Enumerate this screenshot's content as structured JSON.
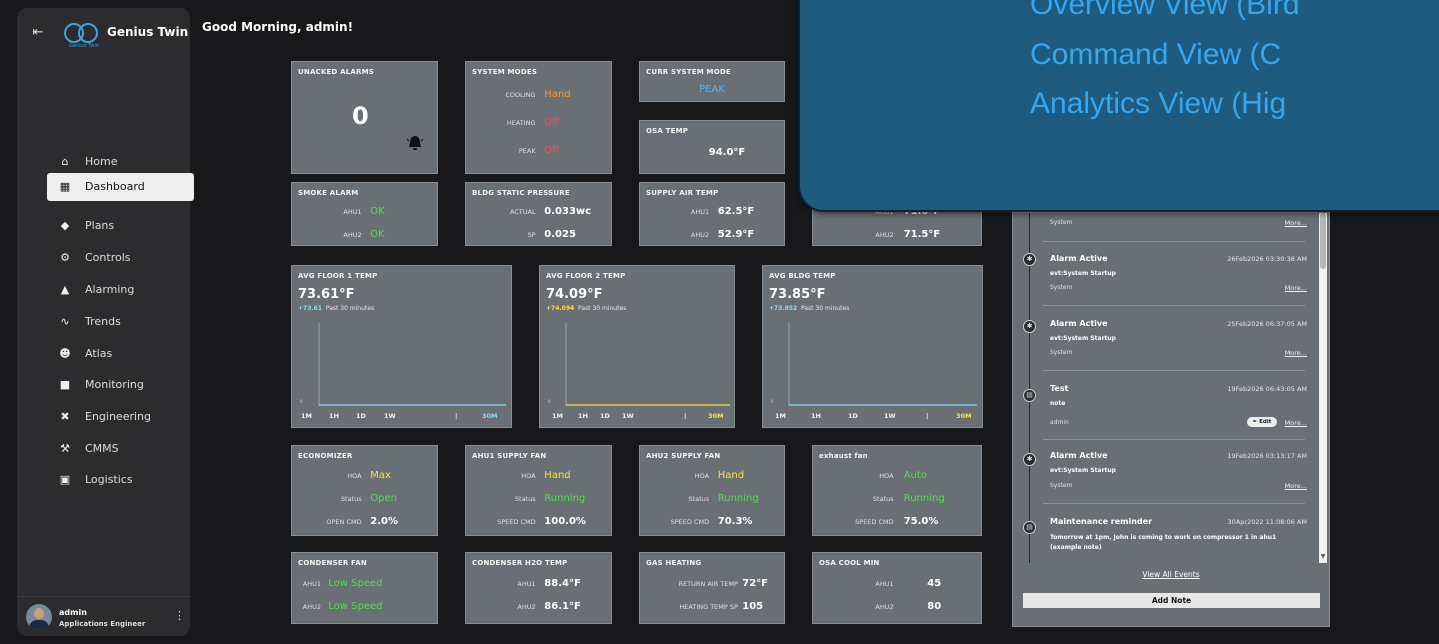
{
  "app": {
    "brand": "Genius Twin",
    "logo_sub": "Genius Twin",
    "greeting": "Good Morning, admin!"
  },
  "sidebar": {
    "items": [
      {
        "label": "Home",
        "icon": "home-icon"
      },
      {
        "label": "Dashboard",
        "icon": "dashboard-icon",
        "active": true
      },
      {
        "label": "Plans",
        "icon": "layers-icon"
      },
      {
        "label": "Controls",
        "icon": "gears-icon"
      },
      {
        "label": "Alarming",
        "icon": "bell-icon"
      },
      {
        "label": "Trends",
        "icon": "trend-icon"
      },
      {
        "label": "Atlas",
        "icon": "people-icon"
      },
      {
        "label": "Monitoring",
        "icon": "camera-icon"
      },
      {
        "label": "Engineering",
        "icon": "tools-icon"
      },
      {
        "label": "CMMS",
        "icon": "wrench-icon"
      },
      {
        "label": "Logistics",
        "icon": "car-icon"
      }
    ],
    "user": {
      "name": "admin",
      "role": "Applications Engineer"
    }
  },
  "popup": {
    "lines": [
      "Overview View (Bird",
      "Command View (C",
      "Analytics View (Hig"
    ]
  },
  "cards": {
    "unacked": {
      "title": "UNACKED ALARMS",
      "value": "0"
    },
    "system_modes": {
      "title": "SYSTEM MODES",
      "rows": [
        {
          "k": "COOLING",
          "v": "Hand"
        },
        {
          "k": "HEATING",
          "v": "Off"
        },
        {
          "k": "PEAK",
          "v": "Off"
        }
      ]
    },
    "curr_mode": {
      "title": "CURR SYSTEM MODE",
      "value": "PEAK"
    },
    "osa_temp": {
      "title": "OSA TEMP",
      "value": "94.0°F"
    },
    "smoke": {
      "title": "SMOKE ALARM",
      "rows": [
        {
          "k": "AHU1",
          "v": "OK"
        },
        {
          "k": "AHU2",
          "v": "OK"
        }
      ]
    },
    "bldg_static": {
      "title": "BLDG STATIC PRESSURE",
      "rows": [
        {
          "k": "ACTUAL",
          "v": "0.033wc"
        },
        {
          "k": "SP",
          "v": "0.025"
        }
      ]
    },
    "supply_air": {
      "title": "SUPPLY AIR TEMP",
      "rows": [
        {
          "k": "AHU1",
          "v": "62.5°F"
        },
        {
          "k": "AHU2",
          "v": "52.9°F"
        }
      ]
    },
    "partial_card": {
      "rows": [
        {
          "k": "AHU1",
          "v": "71.6°F"
        },
        {
          "k": "AHU2",
          "v": "71.5°F"
        }
      ]
    },
    "economizer": {
      "title": "ECONOMIZER",
      "rows": [
        {
          "k": "HOA",
          "v": "Max"
        },
        {
          "k": "Status",
          "v": "Open"
        },
        {
          "k": "OPEN CMD",
          "v": "2.0%"
        }
      ]
    },
    "ahu1_fan": {
      "title": "AHU1 SUPPLY FAN",
      "rows": [
        {
          "k": "HOA",
          "v": "Hand"
        },
        {
          "k": "Status",
          "v": "Running"
        },
        {
          "k": "SPEED CMD",
          "v": "100.0%"
        }
      ]
    },
    "ahu2_fan": {
      "title": "AHU2 SUPPLY FAN",
      "rows": [
        {
          "k": "HOA",
          "v": "Hand"
        },
        {
          "k": "Status",
          "v": "Running"
        },
        {
          "k": "SPEED CMD",
          "v": "70.3%"
        }
      ]
    },
    "exhaust": {
      "title": "exhaust fan",
      "rows": [
        {
          "k": "HOA",
          "v": "Auto"
        },
        {
          "k": "Status",
          "v": "Running"
        },
        {
          "k": "SPEED CMD",
          "v": "75.0%"
        }
      ]
    },
    "condenser_fan": {
      "title": "CONDENSER FAN",
      "rows": [
        {
          "k": "AHU1",
          "v": "Low Speed"
        },
        {
          "k": "AHU2",
          "v": "Low Speed"
        }
      ]
    },
    "condenser_h2o": {
      "title": "CONDENSER H2O TEMP",
      "rows": [
        {
          "k": "AHU1",
          "v": "88.4°F"
        },
        {
          "k": "AHU2",
          "v": "86.1°F"
        }
      ]
    },
    "gas_heating": {
      "title": "GAS HEATING",
      "rows": [
        {
          "k": "RETURN AIR TEMP",
          "v": "72°F"
        },
        {
          "k": "HEATING TEMP SP",
          "v": "105"
        }
      ]
    },
    "osa_cool": {
      "title": "OSA COOL MIN",
      "rows": [
        {
          "k": "AHU1",
          "v": "45"
        },
        {
          "k": "AHU2",
          "v": "80"
        }
      ]
    }
  },
  "trend_cards": [
    {
      "title": "AVG FLOOR 1 TEMP",
      "value": "73.61°F",
      "delta": "+73.61",
      "period": "Past 30 minutes",
      "color": "#7fe0ff"
    },
    {
      "title": "AVG FLOOR 2 TEMP",
      "value": "74.09°F",
      "delta": "+74.094",
      "period": "Past 30 minutes",
      "color": "#ffe33b"
    },
    {
      "title": "AVG BLDG TEMP",
      "value": "73.85°F",
      "delta": "+73.852",
      "period": "Past 30 minutes",
      "color": "#7fe0ff"
    }
  ],
  "timeframes": [
    "1M",
    "1H",
    "1D",
    "1W",
    "|",
    "30M"
  ],
  "events": [
    {
      "title": "",
      "time": "",
      "desc": "",
      "user": "System",
      "more": "More..."
    },
    {
      "title": "Alarm Active",
      "time": "26Feb2026 03:30:38 AM",
      "desc": "evt:System Startup",
      "user": "System",
      "more": "More...",
      "icon": "asterisk"
    },
    {
      "title": "Alarm Active",
      "time": "25Feb2026 06:37:05 AM",
      "desc": "evt:System Startup",
      "user": "System",
      "more": "More...",
      "icon": "asterisk"
    },
    {
      "title": "Test",
      "time": "19Feb2026 06:43:05 AM",
      "desc": "note",
      "user": "admin",
      "more": "More...",
      "edit": "Edit",
      "icon": "note"
    },
    {
      "title": "Alarm Active",
      "time": "19Feb2026 03:13:17 AM",
      "desc": "evt:System Startup",
      "user": "System",
      "more": "More...",
      "icon": "asterisk"
    },
    {
      "title": "Maintenance reminder",
      "time": "30Apr2022 11:08:06 AM",
      "desc": "Tomorrow at 1pm, John is coming to work on compressor 1 in ahu1",
      "desc2": "(example note)",
      "icon": "note"
    }
  ],
  "events_footer": {
    "view_all": "View All Events",
    "add_note": "Add Note"
  }
}
